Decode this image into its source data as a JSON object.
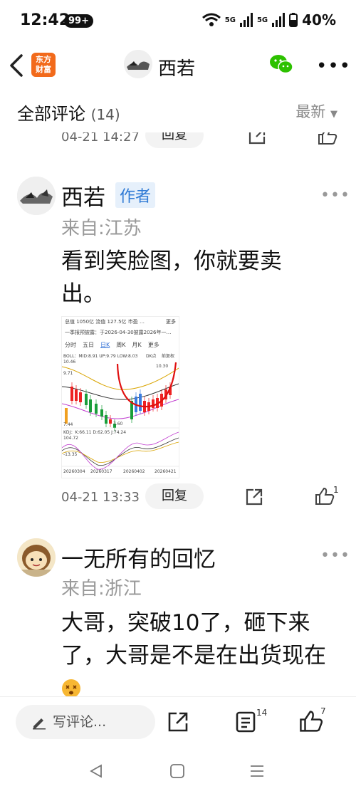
{
  "status": {
    "time": "12:42",
    "badge": "99+",
    "network1": "5G",
    "network2": "5G",
    "battery": "40%"
  },
  "header": {
    "logo_line1": "东方",
    "logo_line2": "财富",
    "title": "西若"
  },
  "subheader": {
    "title": "全部评论",
    "count": "(14)",
    "sort": "最新"
  },
  "prev_comment": {
    "time": "04-21 14:27",
    "reply": "回复"
  },
  "comments": [
    {
      "name": "西若",
      "tag": "作者",
      "from": "来自:江苏",
      "content": "看到笑脸图，你就要卖出。",
      "time": "04-21 13:33",
      "reply": "回复",
      "likes": "1"
    },
    {
      "name": "一无所有的回忆",
      "from": "来自:浙江",
      "content": "大哥，突破10了，砸下来了，大哥是不是在出货现在"
    }
  ],
  "chart_data": {
    "type": "candlestick",
    "header_text": "总值 1050亿  流值 127.5亿  市盈 …",
    "header_more": "更多",
    "notice": "一季报预披露：于2026-04-30披露2026年一…",
    "tabs": [
      "分时",
      "五日",
      "日K",
      "周K",
      "月K",
      "更多"
    ],
    "active_tab": "日K",
    "boll": "BOLL：MID:8.91 UP:9.79 LOW:8.03",
    "dk": "DK点",
    "fq": "前复权",
    "labels": {
      "top": "10.46",
      "mid": "9.71",
      "low": "7.44",
      "last_high": "10.30",
      "min_mark": "7.60"
    },
    "kdj": "KDJ：K:66.11 D:62.05 J:74.24",
    "kdj_labels": {
      "top": "104.72",
      "bottom": "-13.35"
    },
    "dates": [
      "20260304",
      "20260317",
      "20260402",
      "20260421"
    ]
  },
  "bottom": {
    "input_placeholder": "写评论...",
    "comment_count": "14",
    "like_count": "7"
  }
}
